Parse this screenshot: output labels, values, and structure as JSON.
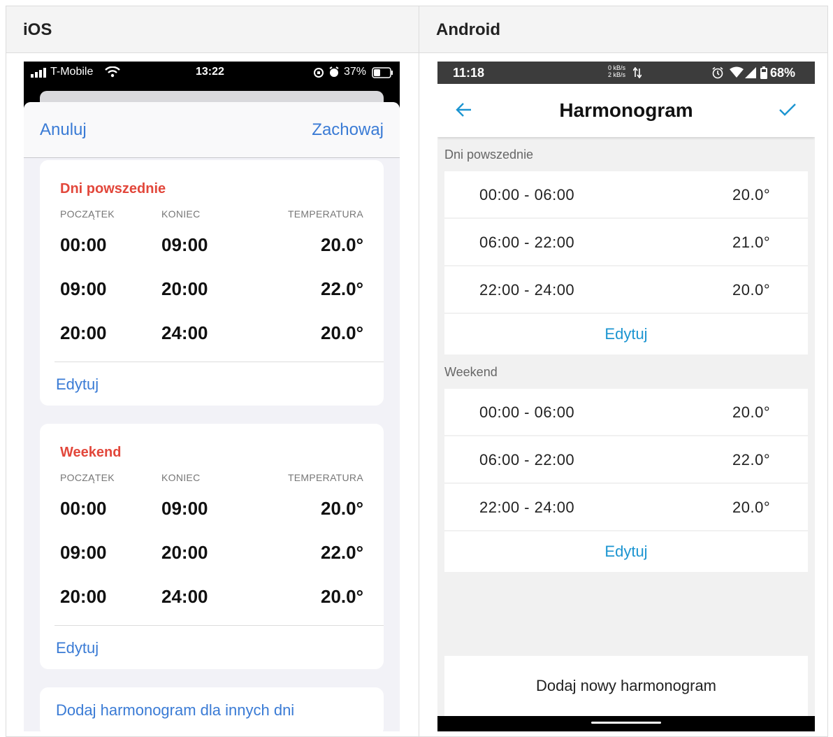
{
  "headers": {
    "ios": "iOS",
    "android": "Android"
  },
  "ios": {
    "status": {
      "carrier": "T-Mobile",
      "time": "13:22",
      "battery": "37%"
    },
    "nav": {
      "cancel": "Anuluj",
      "save": "Zachowaj"
    },
    "columns": {
      "start": "POCZĄTEK",
      "end": "KONIEC",
      "temp": "TEMPERATURA"
    },
    "weekdays": {
      "title": "Dni powszednie",
      "rows": [
        {
          "start": "00:00",
          "end": "09:00",
          "temp": "20.0°"
        },
        {
          "start": "09:00",
          "end": "20:00",
          "temp": "22.0°"
        },
        {
          "start": "20:00",
          "end": "24:00",
          "temp": "20.0°"
        }
      ],
      "edit": "Edytuj"
    },
    "weekend": {
      "title": "Weekend",
      "rows": [
        {
          "start": "00:00",
          "end": "09:00",
          "temp": "20.0°"
        },
        {
          "start": "09:00",
          "end": "20:00",
          "temp": "22.0°"
        },
        {
          "start": "20:00",
          "end": "24:00",
          "temp": "20.0°"
        }
      ],
      "edit": "Edytuj"
    },
    "add_other": "Dodaj harmonogram dla innych dni"
  },
  "android": {
    "status": {
      "time": "11:18",
      "speed_up": "0 kB/s",
      "speed_down": "2 kB/s",
      "battery": "68%"
    },
    "title": "Harmonogram",
    "weekdays": {
      "title": "Dni powszednie",
      "rows": [
        {
          "range": "00:00 - 06:00",
          "temp": "20.0°"
        },
        {
          "range": "06:00 - 22:00",
          "temp": "21.0°"
        },
        {
          "range": "22:00 - 24:00",
          "temp": "20.0°"
        }
      ],
      "edit": "Edytuj"
    },
    "weekend": {
      "title": "Weekend",
      "rows": [
        {
          "range": "00:00 - 06:00",
          "temp": "20.0°"
        },
        {
          "range": "06:00 - 22:00",
          "temp": "22.0°"
        },
        {
          "range": "22:00 - 24:00",
          "temp": "20.0°"
        }
      ],
      "edit": "Edytuj"
    },
    "add_new": "Dodaj nowy harmonogram"
  }
}
